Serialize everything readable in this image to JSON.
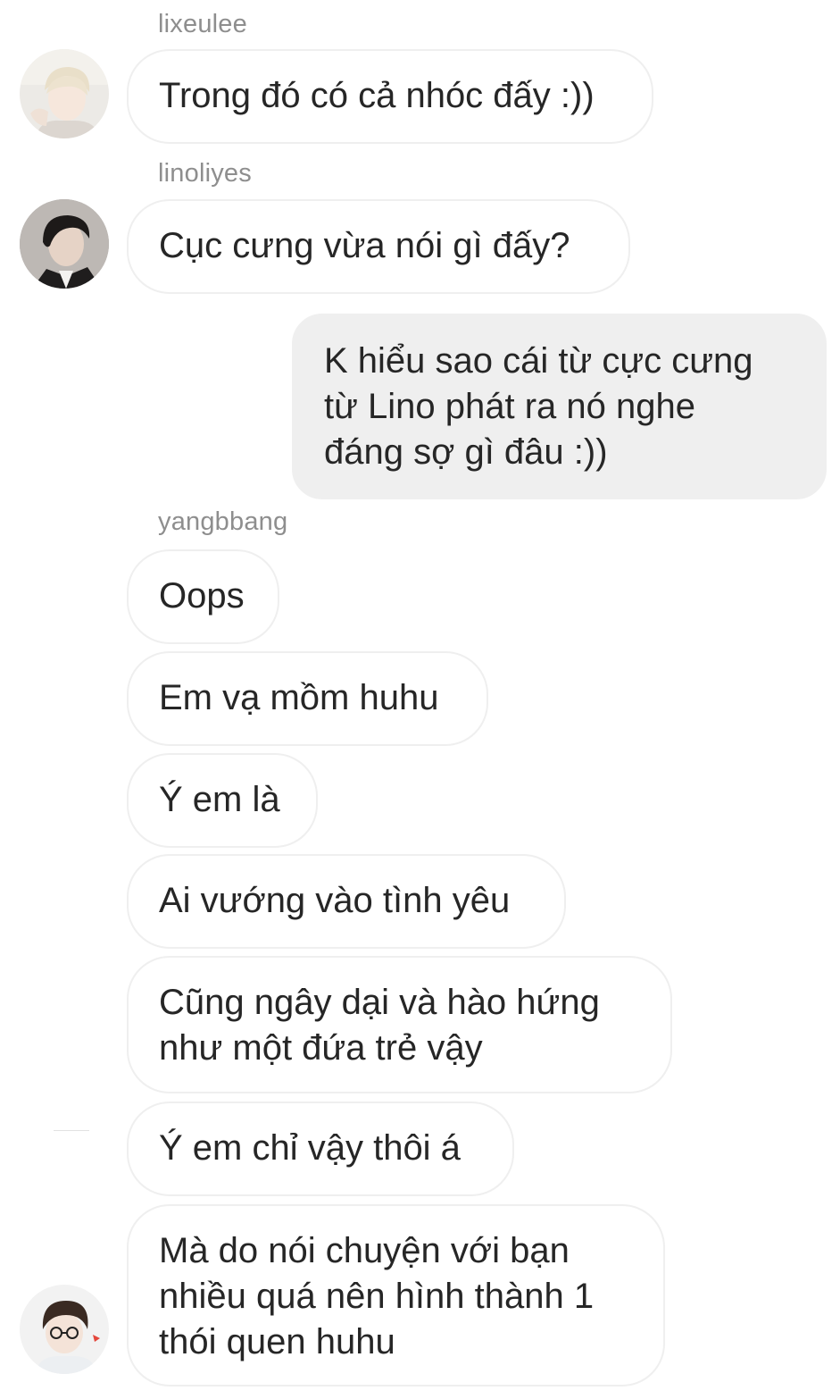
{
  "thread": {
    "groups": [
      {
        "username": "lixeulee",
        "avatar_icon": "user-avatar-light-hair-icon",
        "messages": [
          "Trong đó có cả nhóc đấy :))"
        ]
      },
      {
        "username": "linoliyes",
        "avatar_icon": "user-avatar-dark-hair-icon",
        "messages": [
          "Cục cưng vừa nói gì đấy?"
        ]
      },
      {
        "sent_messages": [
          "K hiểu sao cái từ cực cưng\ntừ Lino phát ra nó nghe\nđáng sợ gì đâu :))"
        ]
      },
      {
        "username": "yangbbang",
        "avatar_icon": "user-avatar-glasses-icon",
        "messages": [
          "Oops",
          "Em vạ mồm huhu",
          "Ý em là",
          "Ai vướng vào tình yêu",
          "Cũng ngây dại và hào hứng\nnhư một đứa trẻ vậy",
          "Ý em chỉ vậy thôi á",
          "Mà do nói chuyện với bạn\nnhiều quá nên hình thành 1\nthói quen huhu"
        ]
      }
    ]
  },
  "colors": {
    "background": "#ffffff",
    "received_bubble_border": "#efefef",
    "sent_bubble_fill": "#efefef",
    "username_text": "#8e8e8e",
    "message_text": "#262626"
  }
}
